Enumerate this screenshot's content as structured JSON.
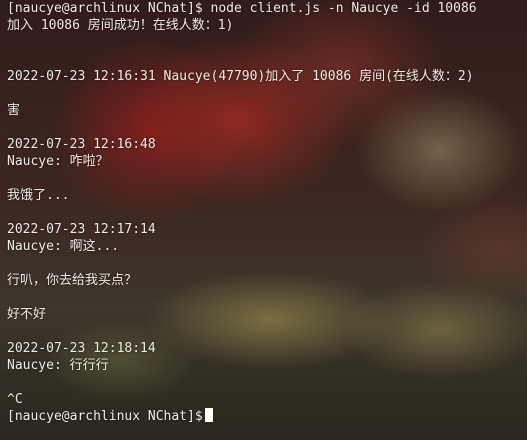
{
  "terminal": {
    "lines": [
      "[naucye@archlinux NChat]$ node client.js -n Naucye -id 10086",
      "加入 10086 房间成功！在线人数：1)",
      "",
      "",
      "2022-07-23 12:16:31 Naucye(47790)加入了 10086 房间(在线人数：2)",
      "",
      "害",
      "",
      "2022-07-23 12:16:48",
      "Naucye: 咋啦？",
      "",
      "我饿了...",
      "",
      "2022-07-23 12:17:14",
      "Naucye: 啊这...",
      "",
      "行叭，你去给我买点？",
      "",
      "好不好",
      "",
      "2022-07-23 12:18:14",
      "Naucye: 行行行",
      "",
      "^C"
    ],
    "prompt": "[naucye@archlinux NChat]$"
  },
  "colors": {
    "text": "#f2ece6",
    "cursor": "#ffffff"
  }
}
